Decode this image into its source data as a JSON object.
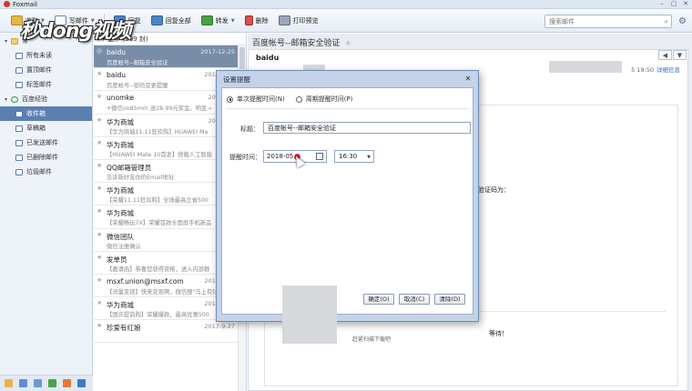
{
  "app": {
    "title": "Foxmail"
  },
  "toolbar": {
    "receive": "收取",
    "compose": "写邮件",
    "reply": "回复",
    "reply_all": "回复全部",
    "forward": "转发",
    "delete": "删除",
    "print_preview": "打印预览"
  },
  "search": {
    "placeholder": "搜索邮件"
  },
  "watermark": "秒dong视频",
  "sidebar": {
    "top_label": "常",
    "top_items": [
      {
        "label": "所有未读"
      },
      {
        "label": "置顶邮件"
      },
      {
        "label": "标签邮件"
      }
    ],
    "account": "百度经验",
    "folders": [
      {
        "label": "收件箱",
        "selected": true
      },
      {
        "label": "草稿箱"
      },
      {
        "label": "已发送邮件"
      },
      {
        "label": "已删除邮件"
      },
      {
        "label": "垃圾邮件"
      }
    ]
  },
  "maillist": {
    "header": "更早 (209 封)",
    "rows": [
      {
        "from": "baidu",
        "date": "2017-12-25",
        "preview": "百度帐号--邮箱安全验证",
        "selected": true
      },
      {
        "from": "baidu",
        "date": "2017-12-8",
        "preview": "百度帐号--密码变更提醒"
      },
      {
        "from": "unomke",
        "date": "2017-12-",
        "preview": "+微信oo85mm 送28-99元奖金。明显→"
      },
      {
        "from": "华为商城",
        "date": "2017-11-",
        "preview": "【华为商城11.11狂欢购】HUAWEI Ma"
      },
      {
        "from": "华为商城",
        "date": "2017-",
        "preview": "【HUAWEI Mate 10首发】搭载人工智能"
      },
      {
        "from": "QQ邮箱管理员",
        "date": "",
        "preview": "告诉新好友你的Email地址"
      },
      {
        "from": "华为商城",
        "date": "",
        "preview": "【荣耀11.11狂欢购】全场最高立省500"
      },
      {
        "from": "华为商城",
        "date": "",
        "preview": "【荣耀畅玩7X】荣耀首款全面屏手机新品"
      },
      {
        "from": "微信团队",
        "date": "2017",
        "preview": "微信注册确认"
      },
      {
        "from": "发单员",
        "date": "2017",
        "preview": "【邀请函】恭喜您获得资格，进入内部群"
      },
      {
        "from": "msxf.union@msxf.com",
        "date": "2017-9-27",
        "preview": "【流量变现】快来变现啊，微信搜\"马上有钱"
      },
      {
        "from": "华为商城",
        "date": "2017-9-27",
        "preview": "【国庆提前购】荣耀爆款，最高优惠500"
      },
      {
        "from": "珍爱有红娘",
        "date": "2017-9-27",
        "preview": ""
      }
    ]
  },
  "reader": {
    "subject": "百度帐号--邮箱安全验证",
    "from": "baidu",
    "time": "5 19:50",
    "detail": "详细信息",
    "body_line1": "验证码为：",
    "body_line2": "等待！",
    "body_line3": "赶紧扫描下载吧"
  },
  "dialog": {
    "title": "设置提醒",
    "radio_once": "单次提醒时间(N)",
    "radio_repeat": "周期提醒时间(P)",
    "title_label": "标题：",
    "title_value": "百度帐号--邮箱安全验证",
    "time_label": "提醒时间：",
    "date_value": "2018-05",
    "time_value": "16:30",
    "ok": "确定(O)",
    "cancel": "取消(C)",
    "clear": "清除(D)"
  },
  "colors": {
    "accent": "#5c7fb2",
    "selected_row": "#7a8da8",
    "brand_red": "#d9342b"
  }
}
